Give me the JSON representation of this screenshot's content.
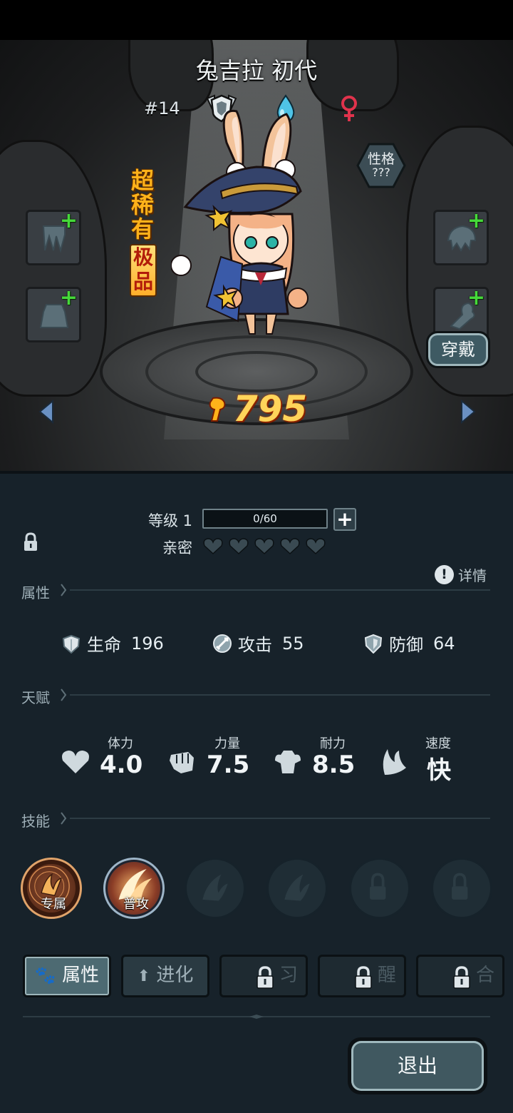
{
  "character": {
    "name": "兔吉拉 初代",
    "number": "#14",
    "rarity": "超稀有",
    "grade": "极品",
    "personality_label": "性格",
    "personality_value": "???",
    "power": "795",
    "wear_label": "穿戴"
  },
  "progress": {
    "level_label": "等级 1",
    "exp_text": "0/60",
    "exp_fraction": 0,
    "intimacy_label": "亲密",
    "hearts_total": 5,
    "hearts_filled": 0
  },
  "detail_label": "详情",
  "attributes": {
    "title": "属性",
    "items": [
      {
        "label": "生命",
        "value": "196",
        "icon": "heart-shield-icon"
      },
      {
        "label": "攻击",
        "value": "55",
        "icon": "sword-icon"
      },
      {
        "label": "防御",
        "value": "64",
        "icon": "shield-icon"
      }
    ]
  },
  "talents": {
    "title": "天赋",
    "items": [
      {
        "label": "体力",
        "value": "4.0",
        "icon": "heart-icon"
      },
      {
        "label": "力量",
        "value": "7.5",
        "icon": "fist-icon"
      },
      {
        "label": "耐力",
        "value": "8.5",
        "icon": "muscle-icon"
      },
      {
        "label": "速度",
        "value": "快",
        "icon": "wing-icon"
      }
    ]
  },
  "skills": {
    "title": "技能",
    "items": [
      {
        "label": "专属",
        "state": "exclusive"
      },
      {
        "label": "普攻",
        "state": "basic"
      },
      {
        "label": "",
        "state": "empty"
      },
      {
        "label": "",
        "state": "empty"
      },
      {
        "label": "",
        "state": "locked"
      },
      {
        "label": "",
        "state": "locked"
      }
    ]
  },
  "tabs": [
    {
      "label": "属性",
      "state": "active"
    },
    {
      "label": "进化",
      "state": "normal"
    },
    {
      "label": "习",
      "state": "locked"
    },
    {
      "label": "醒",
      "state": "locked"
    },
    {
      "label": "合",
      "state": "locked"
    }
  ],
  "exit_label": "退出",
  "colors": {
    "panel_bg": "#17222a",
    "power_gold": "#ffd45a",
    "rarity_orange": "#ffb21a",
    "plus_green": "#46d93a",
    "female_red": "#e0334c",
    "water_blue": "#4fc3e6"
  }
}
